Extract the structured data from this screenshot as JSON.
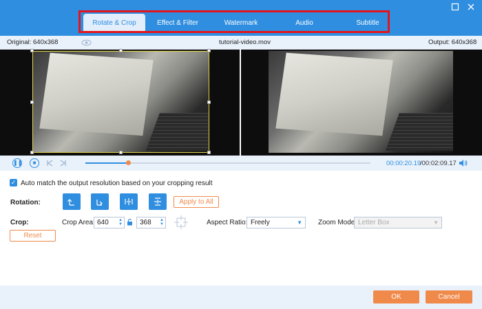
{
  "tabs": [
    {
      "label": "Rotate & Crop",
      "active": true
    },
    {
      "label": "Effect & Filter",
      "active": false
    },
    {
      "label": "Watermark",
      "active": false
    },
    {
      "label": "Audio",
      "active": false
    },
    {
      "label": "Subtitle",
      "active": false
    }
  ],
  "window": {
    "maximize_icon": "maximize-icon",
    "close_icon": "close-icon"
  },
  "info": {
    "original": "Original: 640x368",
    "filename": "tutorial-video.mov",
    "output": "Output: 640x368"
  },
  "playback": {
    "current_time": "00:00:20.19",
    "total_time": "/00:02:09.17",
    "progress": 0.15
  },
  "settings": {
    "auto_match_label": "Auto match the output resolution based on your cropping result",
    "auto_match_checked": true,
    "rotation_label": "Rotation:",
    "apply_to_all": "Apply to All",
    "crop_label": "Crop:",
    "crop_area_label": "Crop Area:",
    "crop_width": "640",
    "crop_height": "368",
    "reset": "Reset",
    "aspect_ratio_label": "Aspect Ratio:",
    "aspect_ratio_value": "Freely",
    "zoom_mode_label": "Zoom Mode:",
    "zoom_mode_value": "Letter Box"
  },
  "footer": {
    "ok": "OK",
    "cancel": "Cancel"
  },
  "colors": {
    "accent": "#2f8ee0",
    "orange": "#f08a4b",
    "highlight": "#e3141b"
  }
}
